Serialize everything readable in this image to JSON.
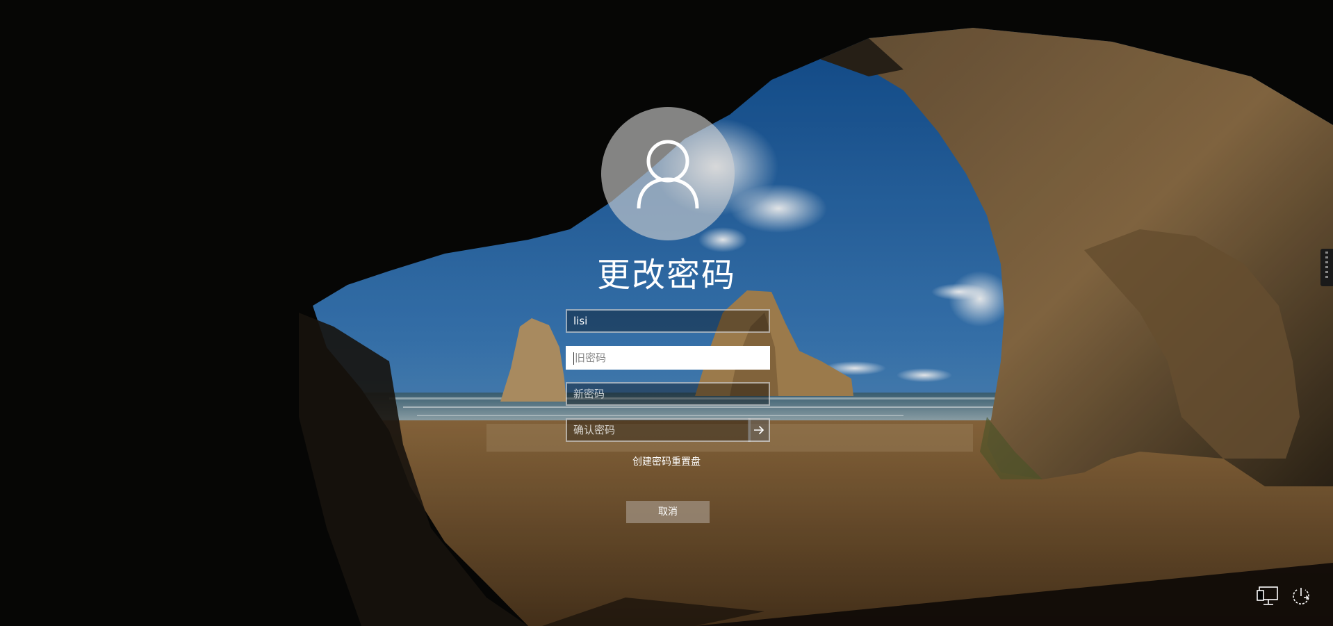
{
  "screen": {
    "title": "更改密码"
  },
  "form": {
    "username_value": "lisi",
    "old_password_placeholder": "旧密码",
    "new_password_placeholder": "新密码",
    "confirm_password_placeholder": "确认密码"
  },
  "links": {
    "reset_disk": "创建密码重置盘"
  },
  "buttons": {
    "cancel": "取消",
    "submit_icon": "arrow-right-icon"
  },
  "tray": {
    "network_icon": "network-icon",
    "power_icon": "power-icon"
  },
  "colors": {
    "text": "#ffffff",
    "cancel_bg": "#a0917f"
  }
}
